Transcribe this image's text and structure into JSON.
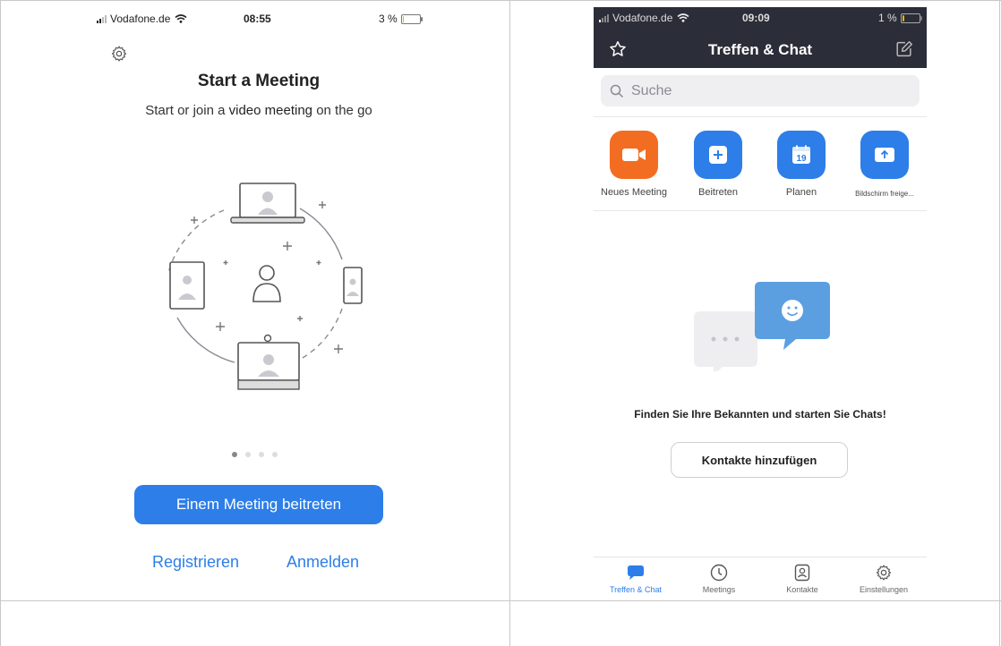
{
  "left_phone": {
    "status": {
      "carrier": "Vodafone.de",
      "time": "08:55",
      "battery": "3 %"
    },
    "title": "Start a Meeting",
    "subtitle_prefix": "Start or join a ",
    "subtitle_bold": "video meeting",
    "subtitle_suffix": " on the go",
    "join_button": "Einem Meeting beitreten",
    "register_link": "Registrieren",
    "login_link": "Anmelden",
    "page_dots": {
      "count": 4,
      "active": 0
    },
    "icons": {
      "settings": "gear-icon"
    }
  },
  "right_phone": {
    "status": {
      "carrier": "Vodafone.de",
      "time": "09:09",
      "battery": "1 %"
    },
    "title": "Treffen & Chat",
    "search_placeholder": "Suche",
    "actions": [
      {
        "label": "Neues Meeting",
        "icon": "video-camera-icon",
        "color": "#f26d21"
      },
      {
        "label": "Beitreten",
        "icon": "plus-icon",
        "color": "#2d7ee8"
      },
      {
        "label": "Planen",
        "icon": "calendar-icon",
        "color": "#2d7ee8",
        "day": "19"
      },
      {
        "label": "Bildschirm freige...",
        "icon": "share-screen-icon",
        "color": "#2d7ee8"
      }
    ],
    "empty_text_bold": "Finden Sie Ihre Bekannten",
    "empty_text_rest": " und starten Sie Chats!",
    "contacts_button": "Kontakte hinzufügen",
    "tabs": [
      {
        "label": "Treffen & Chat",
        "icon": "chat-bubble-icon",
        "active": true
      },
      {
        "label": "Meetings",
        "icon": "clock-icon",
        "active": false
      },
      {
        "label": "Kontakte",
        "icon": "contact-card-icon",
        "active": false
      },
      {
        "label": "Einstellungen",
        "icon": "gear-icon",
        "active": false
      }
    ]
  },
  "colors": {
    "accent": "#2d7ee8",
    "orange": "#f26d21",
    "header_dark": "#2b2d38"
  }
}
